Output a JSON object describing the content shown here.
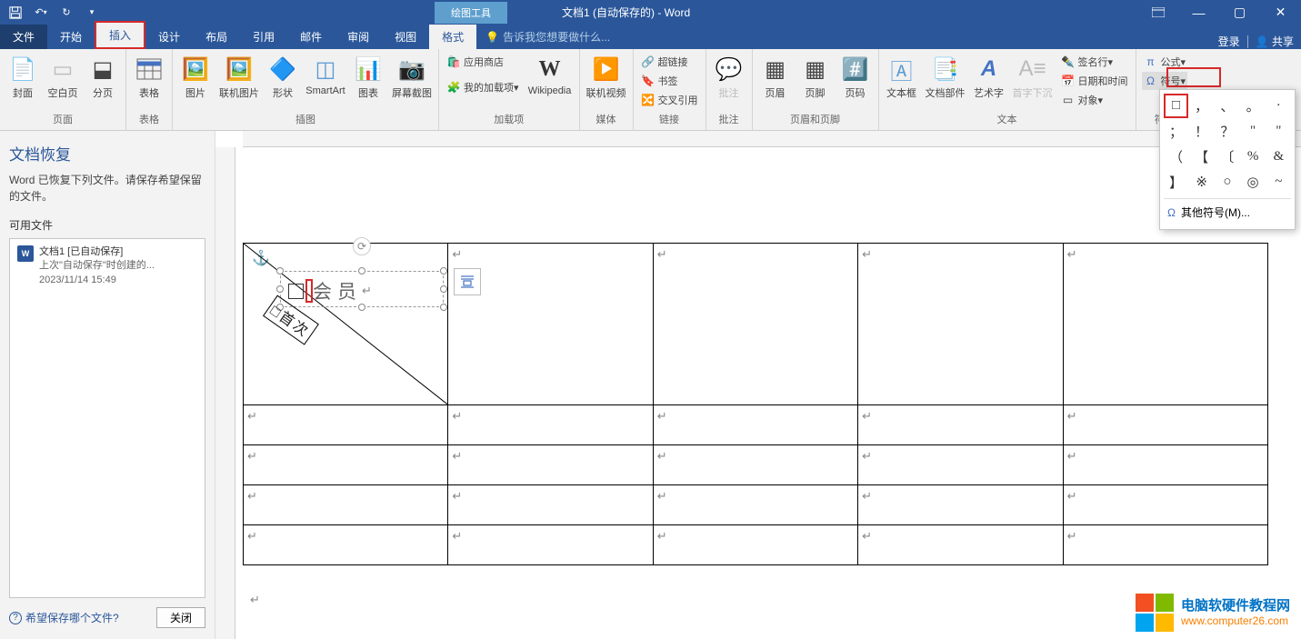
{
  "title_bar": {
    "context_tab": "绘图工具",
    "doc_title": "文档1 (自动保存的) - Word"
  },
  "tabs": {
    "file": "文件",
    "home": "开始",
    "insert": "插入",
    "design": "设计",
    "layout": "布局",
    "references": "引用",
    "mailings": "邮件",
    "review": "审阅",
    "view": "视图",
    "format": "格式",
    "tell_me": "告诉我您想要做什么...",
    "login": "登录",
    "share": "共享"
  },
  "ribbon": {
    "pages": {
      "cover": "封面",
      "blank": "空白页",
      "break": "分页",
      "group": "页面"
    },
    "tables": {
      "table": "表格",
      "group": "表格"
    },
    "illustrations": {
      "picture": "图片",
      "online_pic": "联机图片",
      "shapes": "形状",
      "smartart": "SmartArt",
      "chart": "图表",
      "screenshot": "屏幕截图",
      "group": "插图"
    },
    "addins": {
      "store": "应用商店",
      "myaddins": "我的加载项",
      "wikipedia": "Wikipedia",
      "group": "加载项"
    },
    "media": {
      "video": "联机视频",
      "group": "媒体"
    },
    "links": {
      "hyperlink": "超链接",
      "bookmark": "书签",
      "crossref": "交叉引用",
      "group": "链接"
    },
    "comments": {
      "comment": "批注",
      "group": "批注"
    },
    "headerfooter": {
      "header": "页眉",
      "footer": "页脚",
      "pagenum": "页码",
      "group": "页眉和页脚"
    },
    "text": {
      "textbox": "文本框",
      "docparts": "文档部件",
      "wordart": "艺术字",
      "dropcap": "首字下沉",
      "sig": "签名行",
      "datetime": "日期和时间",
      "object": "对象",
      "group": "文本"
    },
    "symbols": {
      "equation": "公式",
      "symbol": "符号",
      "group": "符号"
    }
  },
  "symbol_menu": {
    "cells": [
      "□",
      "，",
      "、",
      "。",
      "·",
      "；",
      "！",
      "？",
      "\"",
      "\"",
      "（",
      "【",
      "〔",
      "%",
      "&",
      "】",
      "※",
      "○",
      "◎",
      "~"
    ],
    "more": "其他符号(M)..."
  },
  "recovery": {
    "title": "文档恢复",
    "desc": "Word 已恢复下列文件。请保存希望保留的文件。",
    "avail": "可用文件",
    "file": {
      "name": "文档1 [已自动保存]",
      "line2": "上次\"自动保存\"时创建的...",
      "date": "2023/11/14 15:49"
    },
    "footer_q": "希望保存哪个文件?",
    "close": "关闭"
  },
  "doc": {
    "textbox_label": "会员",
    "diag_label": "首次"
  },
  "watermark": {
    "title": "电脑软硬件教程网",
    "url": "www.computer26.com"
  }
}
